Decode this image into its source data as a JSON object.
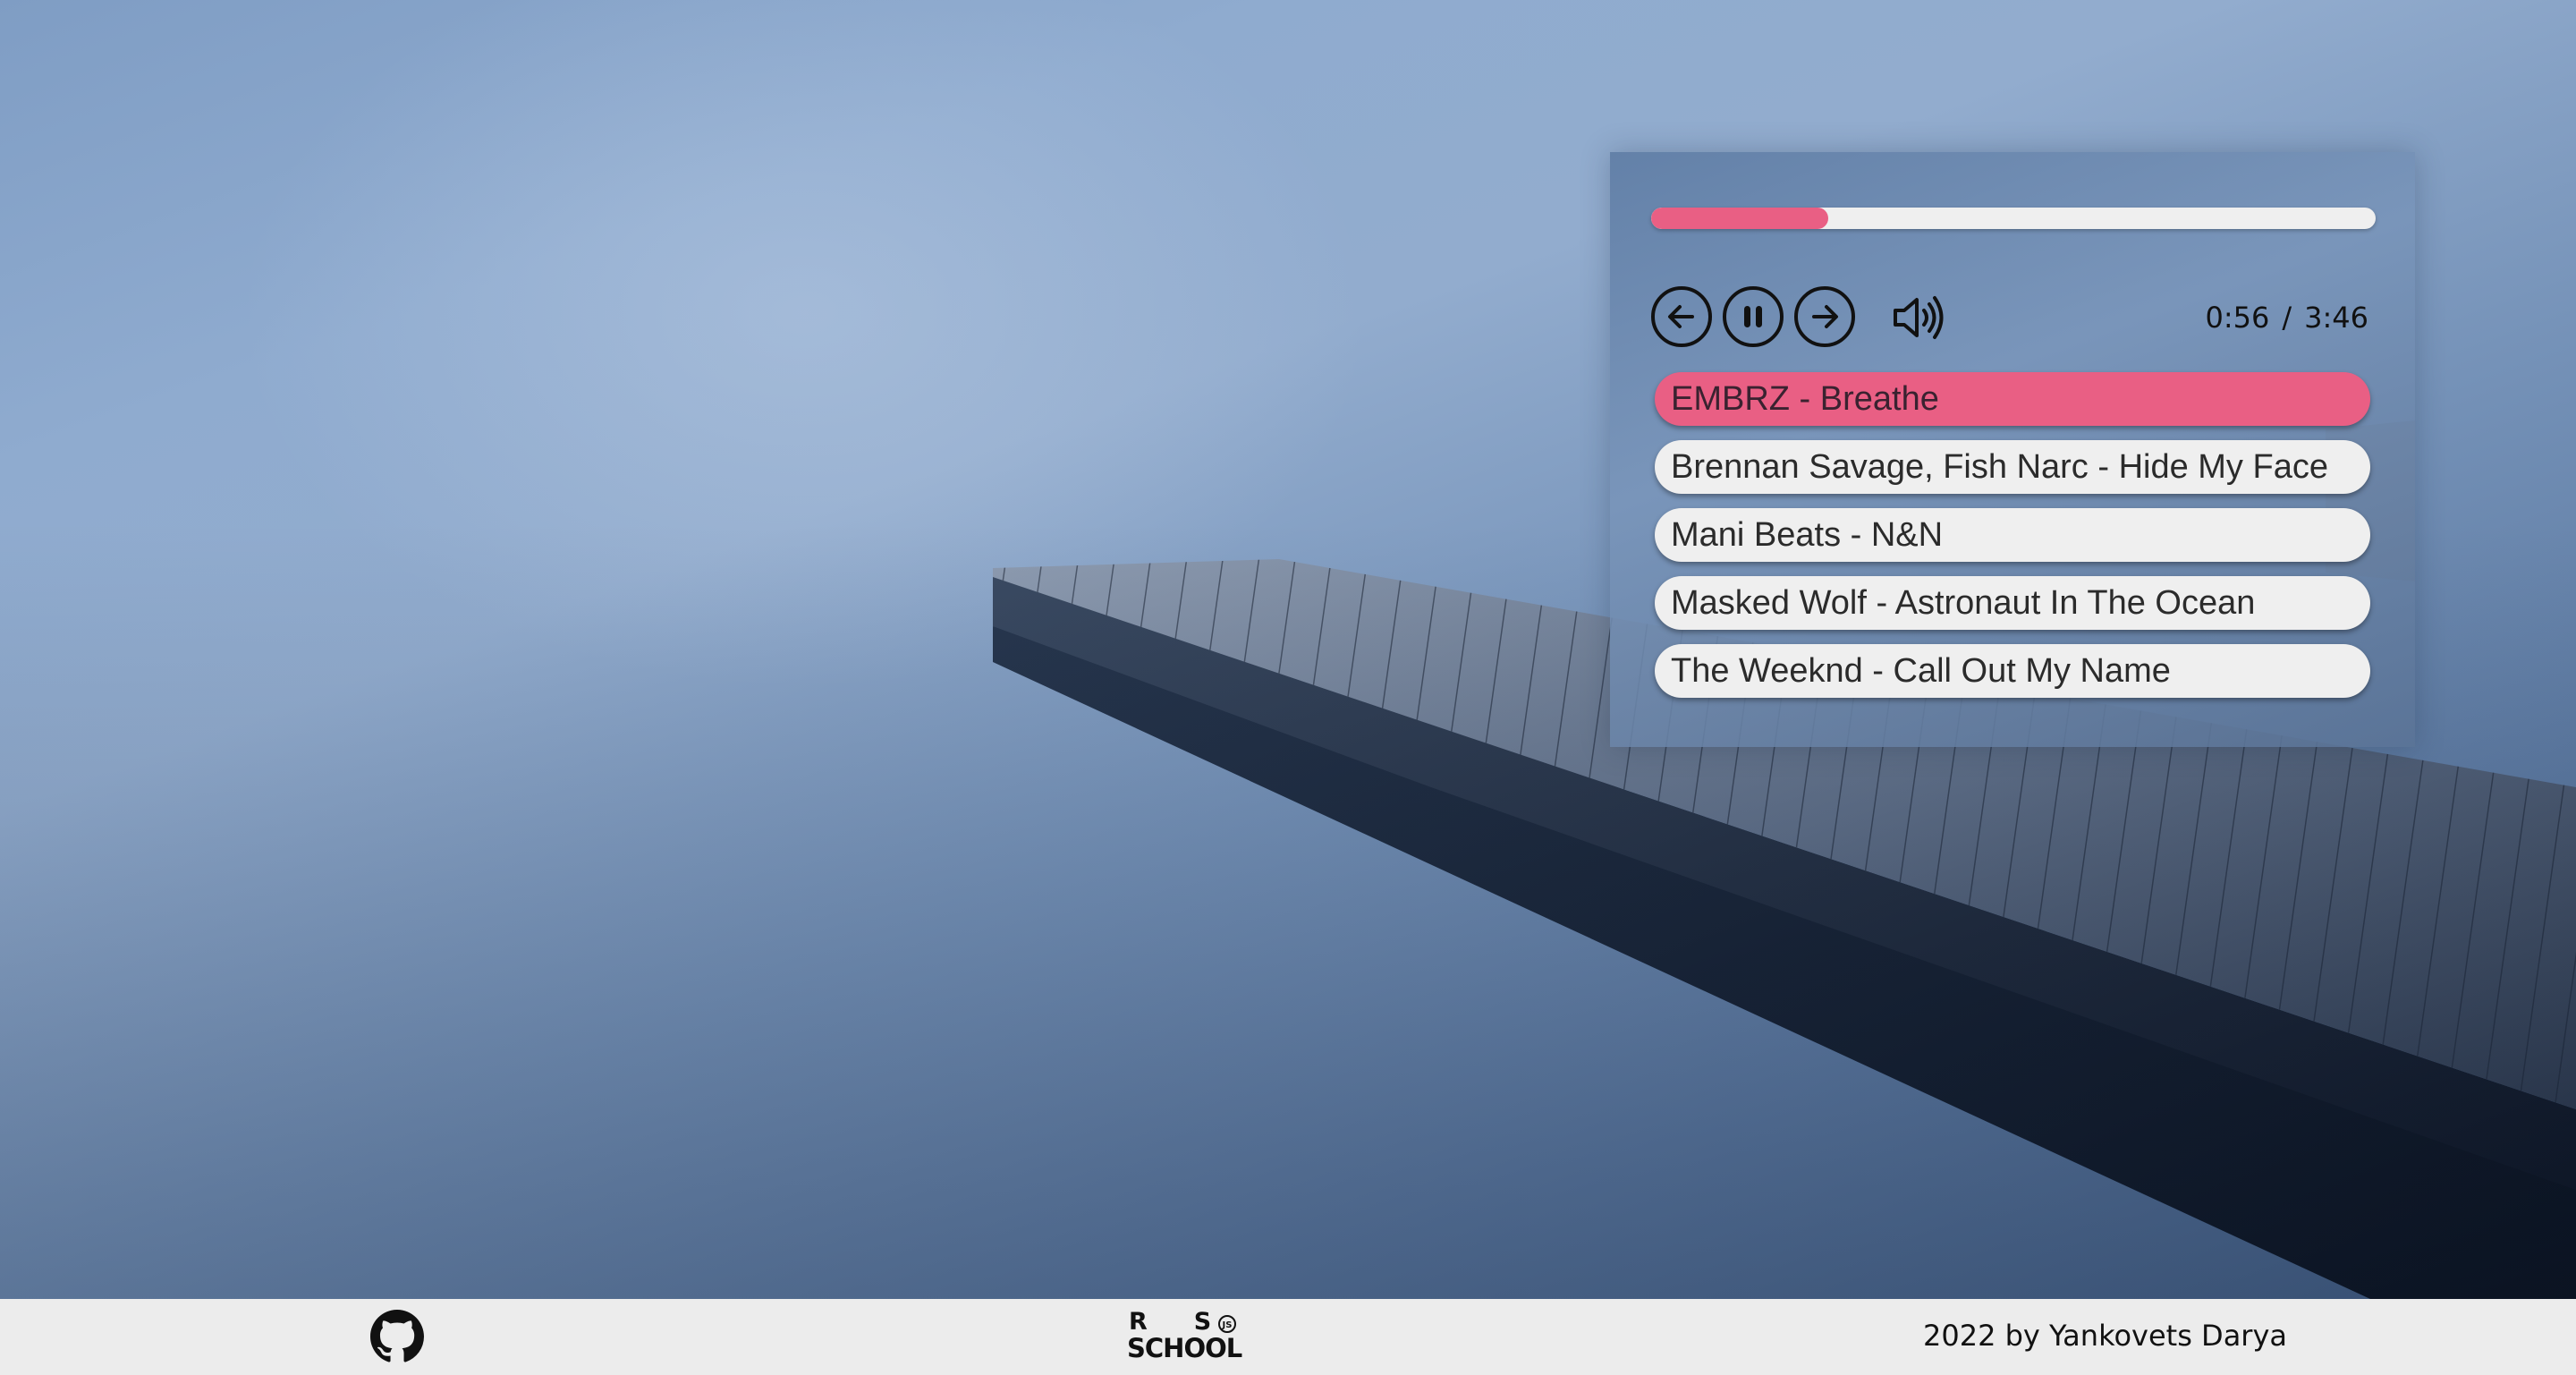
{
  "player": {
    "progress_fraction": 0.245,
    "current_time": "0:56",
    "separator": "/",
    "duration": "3:46",
    "controls": {
      "prev_icon": "arrow-left-icon",
      "play_pause_icon": "pause-icon",
      "next_icon": "arrow-right-icon",
      "volume_icon": "volume-icon"
    },
    "tracks": [
      "EMBRZ - Breathe",
      "Brennan Savage, Fish Narc - Hide My Face",
      "Mani Beats - N&N",
      "Masked Wolf - Astronaut In The Ocean",
      "The Weeknd - Call Out My Name"
    ],
    "active_track_index": 0
  },
  "footer": {
    "github_icon": "github-icon",
    "logo": {
      "line1": "RS",
      "line2": "SCHOOL",
      "badge": "JS"
    },
    "copyright": "2022 by Yankovets Darya"
  },
  "colors": {
    "accent": "#e95f84",
    "track_bg": "#efefef",
    "footer_bg": "#ececec"
  }
}
